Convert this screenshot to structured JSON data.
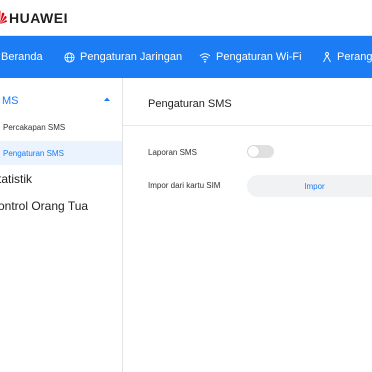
{
  "brand": {
    "name": "HUAWEI",
    "color": "#e60012"
  },
  "nav": {
    "items": [
      {
        "label": "Beranda",
        "icon": "none"
      },
      {
        "label": "Pengaturan Jaringan",
        "icon": "globe-icon"
      },
      {
        "label": "Pengaturan Wi-Fi",
        "icon": "wifi-icon"
      },
      {
        "label": "Perangi",
        "icon": "router-icon"
      }
    ],
    "background": "#1b7cf3"
  },
  "sidebar": {
    "group_label": "SMS",
    "group_label_visible": "MS",
    "group_expanded": true,
    "sub_items": [
      {
        "label": "Percakapan SMS",
        "active": false
      },
      {
        "label": "Pengaturan SMS",
        "active": true
      }
    ],
    "top_items": [
      {
        "label": "tatistik"
      },
      {
        "label": "ontrol Orang Tua"
      }
    ]
  },
  "content": {
    "title": "Pengaturan SMS",
    "sms_report_label": "Laporan SMS",
    "sms_report_enabled": false,
    "import_label": "Impor dari kartu SIM",
    "import_button_label": "Impor"
  },
  "colors": {
    "accent": "#1b7cf3",
    "active_bg": "#eaf3fe"
  }
}
